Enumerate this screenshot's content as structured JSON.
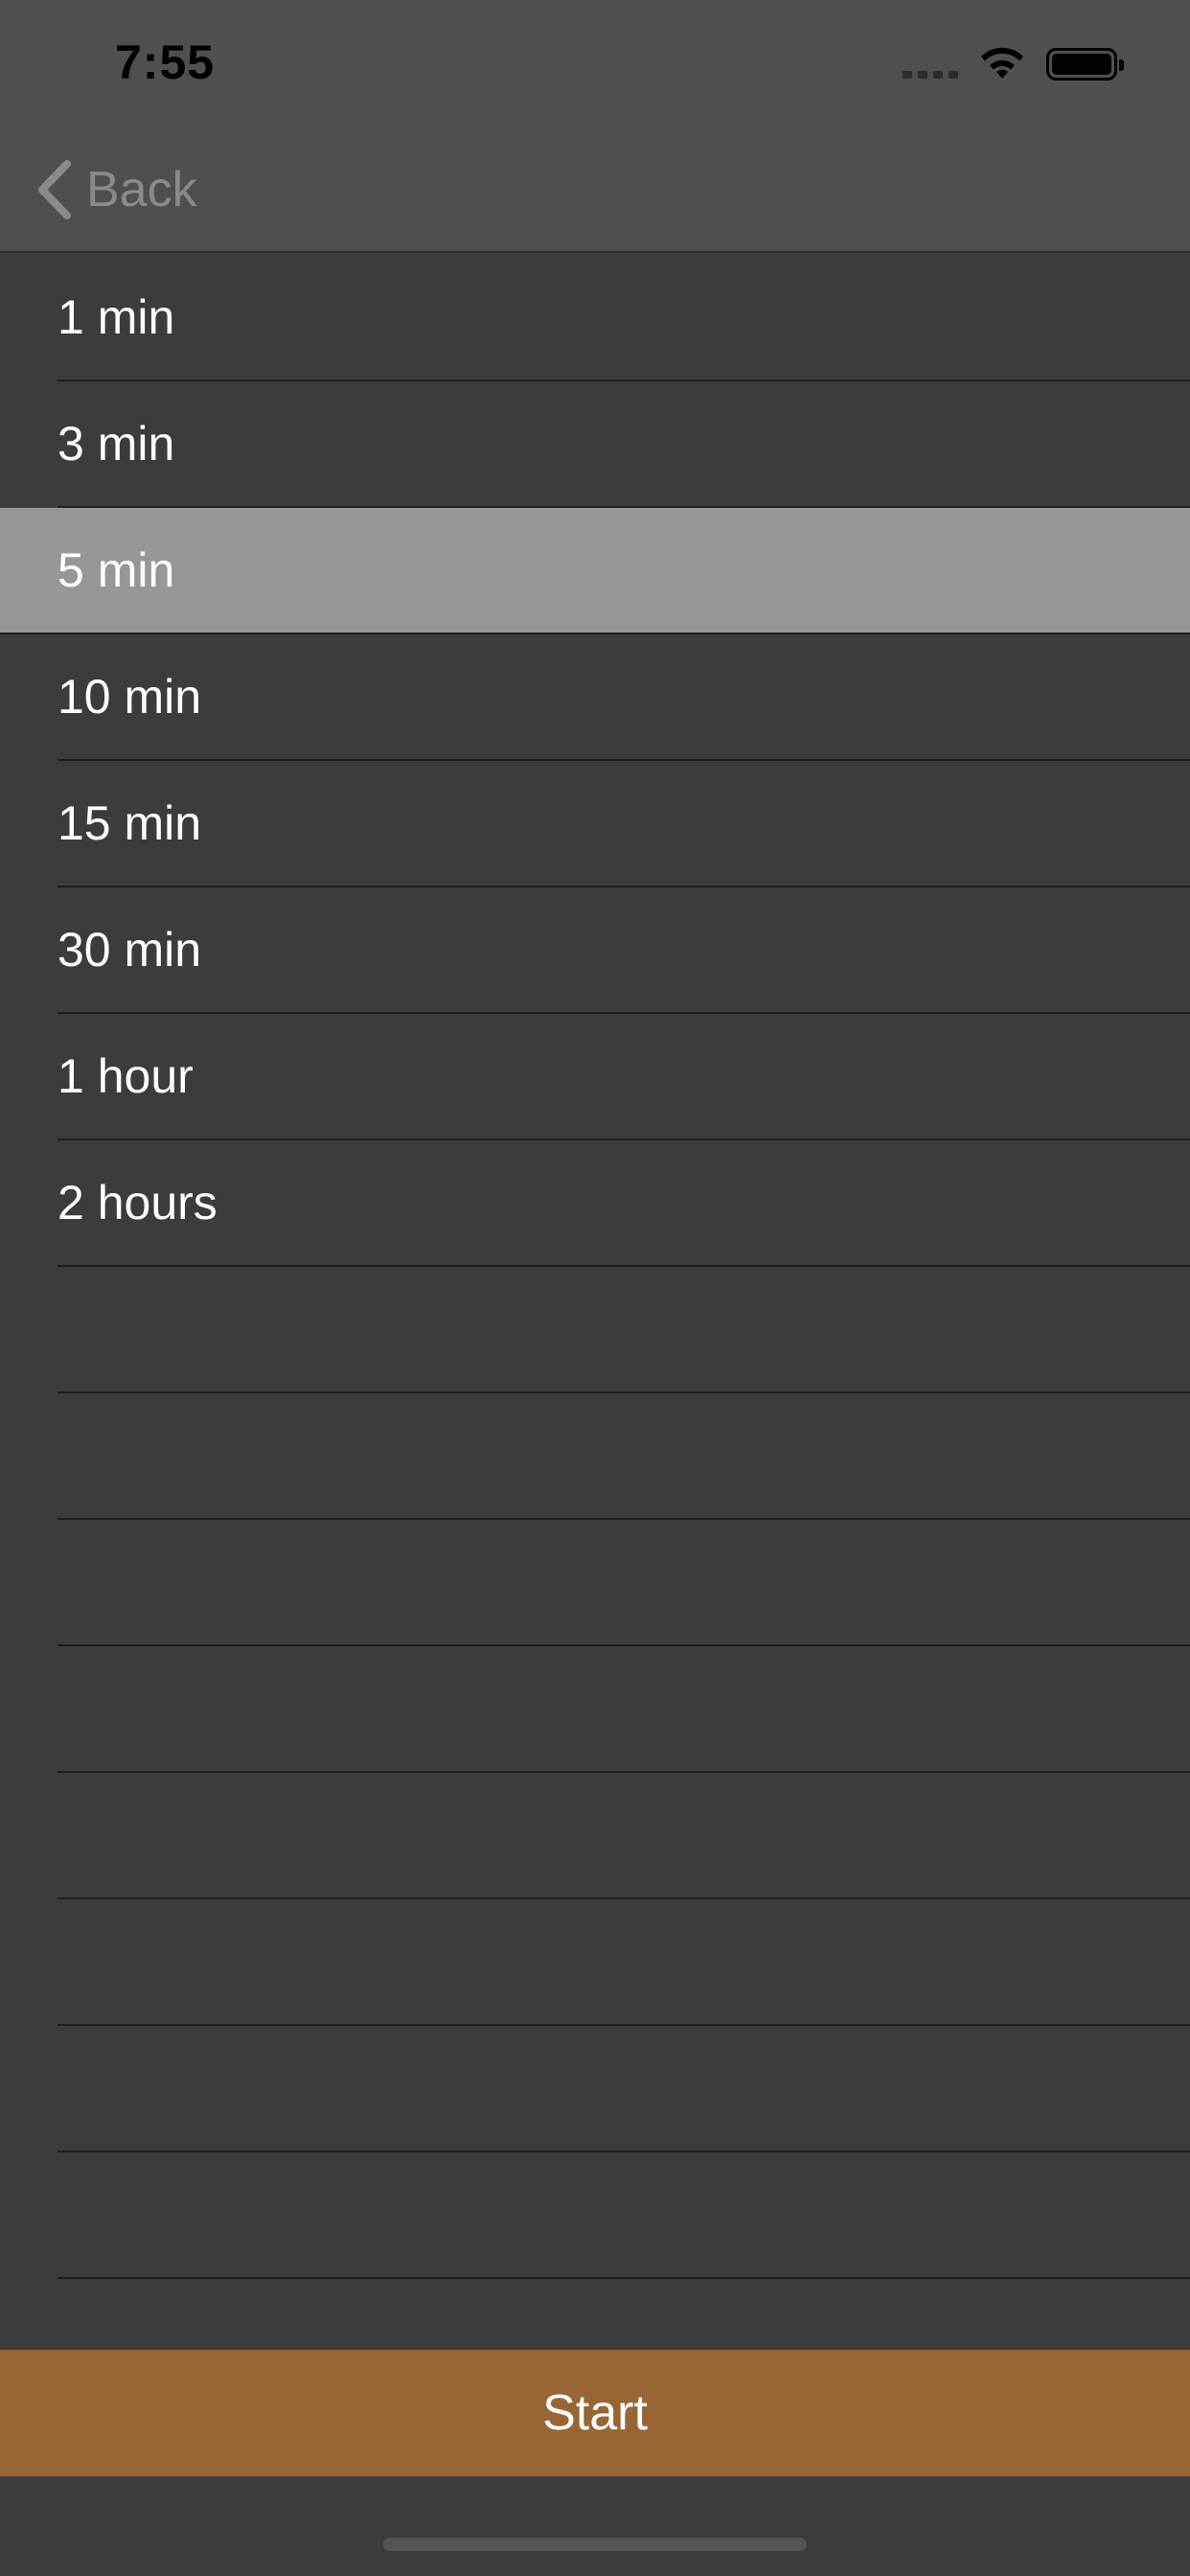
{
  "status_bar": {
    "time": "7:55",
    "icons": [
      "signal-icon",
      "wifi-icon",
      "battery-icon"
    ]
  },
  "nav": {
    "back_label": "Back",
    "back_icon": "chevron-left-icon"
  },
  "list": {
    "items": [
      {
        "label": "1 min",
        "selected": false
      },
      {
        "label": "3 min",
        "selected": false
      },
      {
        "label": "5 min",
        "selected": true
      },
      {
        "label": "10 min",
        "selected": false
      },
      {
        "label": "15 min",
        "selected": false
      },
      {
        "label": "30 min",
        "selected": false
      },
      {
        "label": "1 hour",
        "selected": false
      },
      {
        "label": "2 hours",
        "selected": false
      }
    ],
    "empty_rows": 8
  },
  "start_button": {
    "label": "Start"
  },
  "colors": {
    "header_bg": "#4f4f4f",
    "list_bg": "#3c3c3c",
    "selected_bg": "#979797",
    "start_bg": "#986634",
    "text": "#ffffff",
    "back_text": "#8a8a8a"
  }
}
